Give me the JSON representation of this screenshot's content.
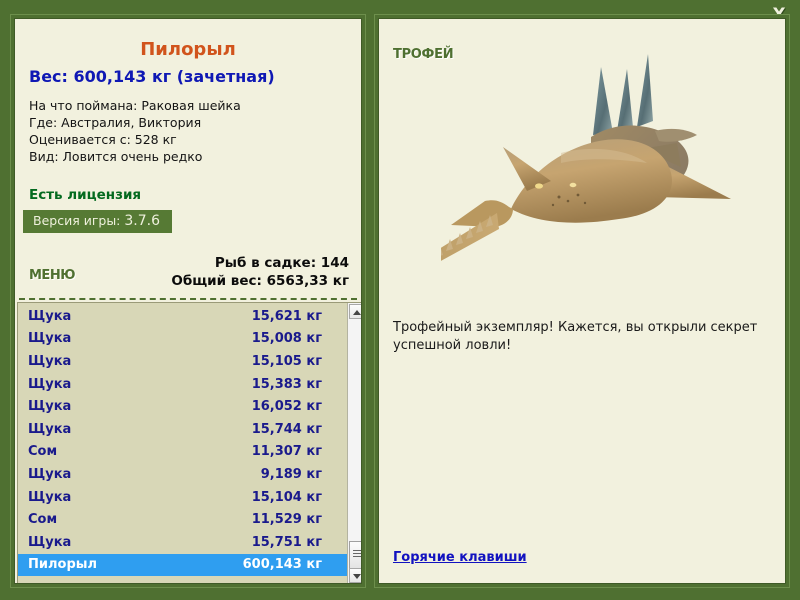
{
  "window": {
    "close_label": "X"
  },
  "catch": {
    "title": "Пилорыл",
    "weight_line": "Вес: 600,143 кг (зачетная)",
    "info": [
      "На что поймана: Раковая шейка",
      "Где: Австралия, Виктория",
      "Оценивается с: 528 кг",
      "Вид: Ловится очень редко"
    ],
    "license": "Есть лицензия",
    "version_prefix": "Версия игры:",
    "version_number": "3.7.6"
  },
  "menu": {
    "label": "МЕНЮ"
  },
  "stats": {
    "fish_in_keepnet": "Рыб в садке: 144",
    "total_weight": "Общий вес: 6563,33 кг"
  },
  "fish_list": [
    {
      "name": "Щука",
      "weight": "15,621 кг",
      "selected": false
    },
    {
      "name": "Щука",
      "weight": "15,008 кг",
      "selected": false
    },
    {
      "name": "Щука",
      "weight": "15,105 кг",
      "selected": false
    },
    {
      "name": "Щука",
      "weight": "15,383 кг",
      "selected": false
    },
    {
      "name": "Щука",
      "weight": "16,052 кг",
      "selected": false
    },
    {
      "name": "Щука",
      "weight": "15,744 кг",
      "selected": false
    },
    {
      "name": "Сом",
      "weight": "11,307 кг",
      "selected": false
    },
    {
      "name": "Щука",
      "weight": "9,189 кг",
      "selected": false
    },
    {
      "name": "Щука",
      "weight": "15,104 кг",
      "selected": false
    },
    {
      "name": "Сом",
      "weight": "11,529 кг",
      "selected": false
    },
    {
      "name": "Щука",
      "weight": "15,751 кг",
      "selected": false
    },
    {
      "name": "Пилорыл",
      "weight": "600,143 кг",
      "selected": true
    }
  ],
  "trophy": {
    "label": "ТРОФЕЙ",
    "image_name": "sawfish-trophy-image",
    "description": "Трофейный экземпляр! Кажется, вы открыли секрет успешной ловли!"
  },
  "footer": {
    "hotkeys_link": "Горячие клавиши"
  },
  "colors": {
    "background_green": "#4f7031",
    "panel_cream": "#f2f1de",
    "list_khaki": "#d8d7b7",
    "title_orange": "#d1541c",
    "weight_blue": "#0f18b4",
    "license_green": "#046a1f",
    "selection_blue": "#2f9ef0",
    "link_blue": "#1212c0"
  }
}
